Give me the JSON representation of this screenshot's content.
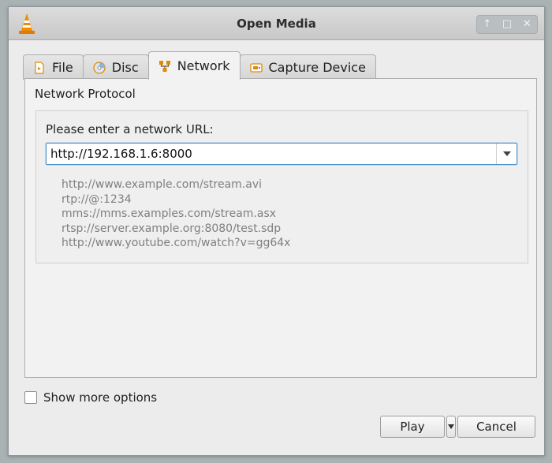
{
  "window": {
    "title": "Open Media"
  },
  "tabs": [
    {
      "id": "file",
      "label": "File",
      "mnemonic": "F",
      "icon": "file-icon",
      "active": false
    },
    {
      "id": "disc",
      "label": "Disc",
      "mnemonic": "D",
      "icon": "disc-icon",
      "active": false
    },
    {
      "id": "network",
      "label": "Network",
      "mnemonic": "N",
      "icon": "network-icon",
      "active": true
    },
    {
      "id": "capture",
      "label": "Capture Device",
      "mnemonic": "D",
      "icon": "capture-device-icon",
      "active": false
    }
  ],
  "network": {
    "section_label": "Network Protocol",
    "url_label": "Please enter a network URL:",
    "url_value": "http://192.168.1.6:8000",
    "examples": [
      "http://www.example.com/stream.avi",
      "rtp://@:1234",
      "mms://mms.examples.com/stream.asx",
      "rtsp://server.example.org:8080/test.sdp",
      "http://www.youtube.com/watch?v=gg64x"
    ]
  },
  "options": {
    "show_more_label": "Show more options",
    "checked": false
  },
  "buttons": {
    "play": "Play",
    "cancel": "Cancel"
  },
  "colors": {
    "accent": "#4a90c8",
    "vlc_orange": "#f08c00"
  }
}
